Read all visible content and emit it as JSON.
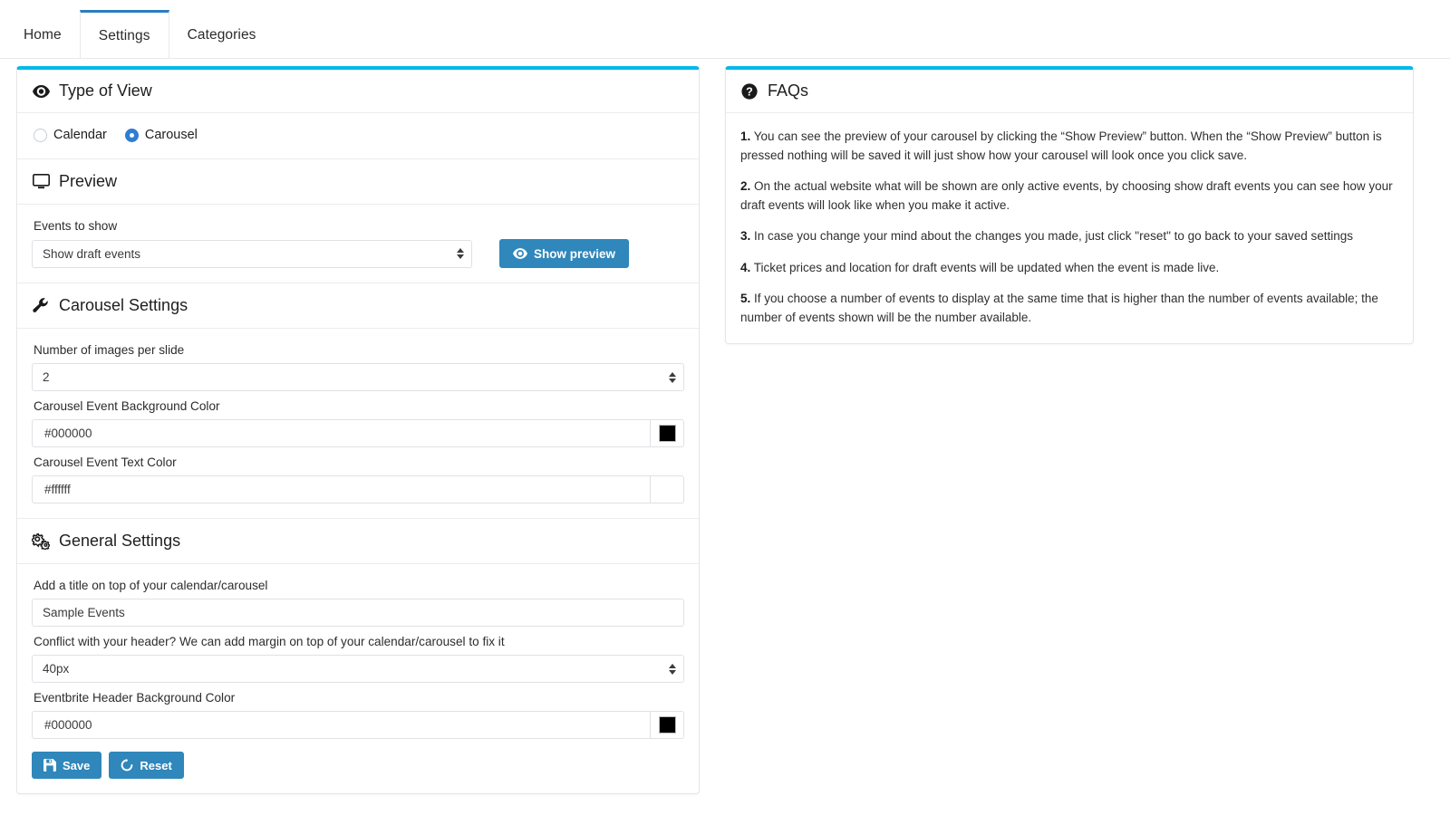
{
  "tabs": [
    {
      "label": "Home",
      "active": false
    },
    {
      "label": "Settings",
      "active": true
    },
    {
      "label": "Categories",
      "active": false
    }
  ],
  "colors": {
    "panel_top_border": "#00b9ea",
    "tab_active_underline": "#2b7dbf",
    "button_blue": "#2f87bb",
    "radio_blue": "#2e7dd1"
  },
  "type_of_view": {
    "title": "Type of View",
    "icon": "eye-icon",
    "options": [
      {
        "label": "Calendar",
        "selected": false
      },
      {
        "label": "Carousel",
        "selected": true
      }
    ]
  },
  "preview": {
    "title": "Preview",
    "icon": "desktop-icon",
    "events_to_show_label": "Events to show",
    "events_to_show_value": "Show draft events",
    "show_preview_button": "Show preview",
    "show_preview_icon": "eye-icon"
  },
  "carousel_settings": {
    "title": "Carousel Settings",
    "icon": "wrench-icon",
    "images_per_slide_label": "Number of images per slide",
    "images_per_slide_value": "2",
    "background_color_label": "Carousel Event Background Color",
    "background_color_value": "#000000",
    "text_color_label": "Carousel Event Text Color",
    "text_color_value": "#ffffff"
  },
  "general_settings": {
    "title": "General Settings",
    "icon": "cogs-icon",
    "title_field_label": "Add a title on top of your calendar/carousel",
    "title_field_value": "Sample Events",
    "margin_field_label": "Conflict with your header? We can add margin on top of your calendar/carousel to fix it",
    "margin_field_value": "40px",
    "header_bg_label": "Eventbrite Header Background Color",
    "header_bg_value": "#000000",
    "save_label": "Save",
    "save_icon": "floppy-save-icon",
    "reset_label": "Reset",
    "reset_icon": "undo-icon"
  },
  "faqs": {
    "title": "FAQs",
    "icon": "question-circle-icon",
    "items": [
      {
        "num": "1.",
        "text": "You can see the preview of your carousel by clicking the “Show Preview” button. When the “Show Preview” button is pressed nothing will be saved it will just show how your carousel will look once you click save."
      },
      {
        "num": "2.",
        "text": "On the actual website what will be shown are only active events, by choosing show draft events you can see how your draft events will look like when you make it active."
      },
      {
        "num": "3.",
        "text": "In case you change your mind about the changes you made, just click \"reset\" to go back to your saved settings"
      },
      {
        "num": "4.",
        "text": "Ticket prices and location for draft events will be updated when the event is made live."
      },
      {
        "num": "5.",
        "text": "If you choose a number of events to display at the same time that is higher than the number of events available; the number of events shown will be the number available."
      }
    ]
  }
}
